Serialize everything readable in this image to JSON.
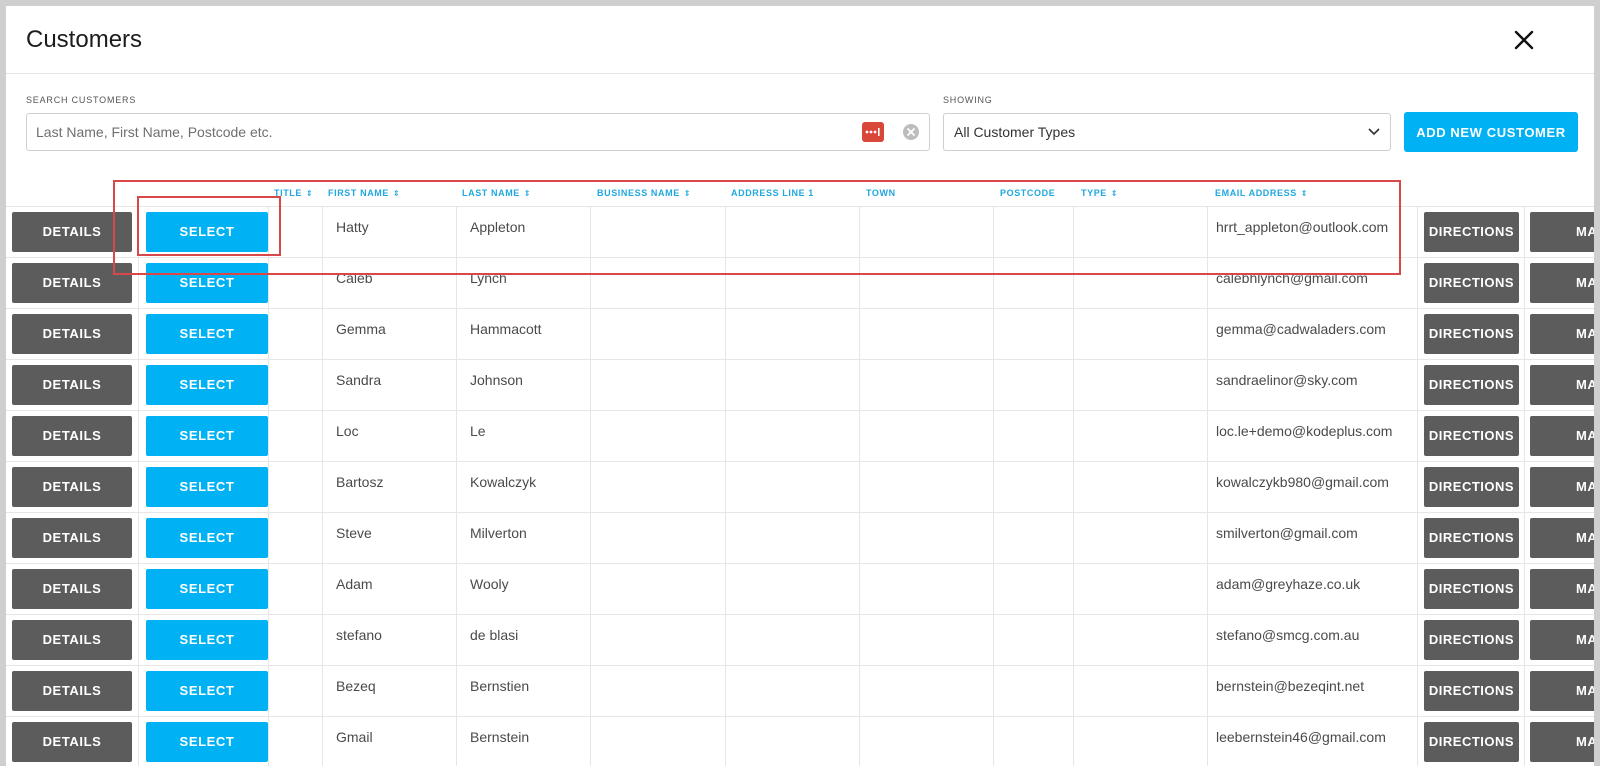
{
  "header": {
    "title": "Customers"
  },
  "search": {
    "label": "SEARCH CUSTOMERS",
    "placeholder": "Last Name, First Name, Postcode etc."
  },
  "filter": {
    "label": "SHOWING",
    "selected": "All Customer Types"
  },
  "actions": {
    "add_new_customer": "ADD NEW CUSTOMER"
  },
  "table": {
    "columns": {
      "title": "TITLE",
      "first_name": "FIRST NAME",
      "last_name": "LAST NAME",
      "business_name": "BUSINESS NAME",
      "address_line_1": "ADDRESS LINE 1",
      "town": "TOWN",
      "postcode": "POSTCODE",
      "type": "TYPE",
      "email_address": "EMAIL ADDRESS"
    },
    "row_buttons": {
      "details": "DETAILS",
      "select": "SELECT",
      "directions": "DIRECTIONS",
      "map": "MA"
    },
    "rows": [
      {
        "first_name": "Hatty",
        "last_name": "Appleton",
        "email": "hrrt_appleton@outlook.com"
      },
      {
        "first_name": "Caleb",
        "last_name": "Lynch",
        "email": "calebhlynch@gmail.com"
      },
      {
        "first_name": "Gemma",
        "last_name": "Hammacott",
        "email": "gemma@cadwaladers.com"
      },
      {
        "first_name": "Sandra",
        "last_name": "Johnson",
        "email": "sandraelinor@sky.com"
      },
      {
        "first_name": "Loc",
        "last_name": "Le",
        "email": "loc.le+demo@kodeplus.com"
      },
      {
        "first_name": "Bartosz",
        "last_name": "Kowalczyk",
        "email": "kowalczykb980@gmail.com"
      },
      {
        "first_name": "Steve",
        "last_name": "Milverton",
        "email": "smilverton@gmail.com"
      },
      {
        "first_name": "Adam",
        "last_name": "Wooly",
        "email": "adam@greyhaze.co.uk"
      },
      {
        "first_name": "stefano",
        "last_name": "de blasi",
        "email": "stefano@smcg.com.au"
      },
      {
        "first_name": "Bezeq",
        "last_name": "Bernstien",
        "email": "bernstein@bezeqint.net"
      },
      {
        "first_name": "Gmail",
        "last_name": "Bernstein",
        "email": "leebernstein46@gmail.com"
      }
    ]
  },
  "colors": {
    "accent": "#00b2f4",
    "button_dark": "#5c5c5c",
    "header_link": "#20a7df",
    "highlight": "#d94848"
  }
}
